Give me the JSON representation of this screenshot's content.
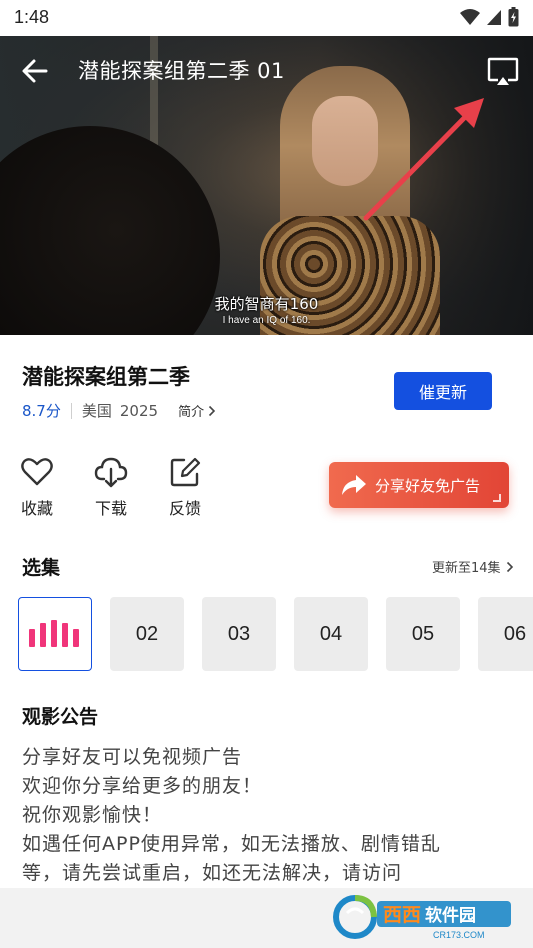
{
  "status_bar": {
    "time": "1:48"
  },
  "player": {
    "title": "潜能探案组第二季 01",
    "subtitle_cn": "我的智商有160",
    "subtitle_en": "I have an IQ of 160."
  },
  "show": {
    "title": "潜能探案组第二季",
    "score": "8.7分",
    "region": "美国",
    "year": "2025",
    "intro_label": "简介",
    "urge_button": "催更新"
  },
  "actions": [
    {
      "label": "收藏",
      "icon": "heart-icon"
    },
    {
      "label": "下载",
      "icon": "cloud-download-icon"
    },
    {
      "label": "反馈",
      "icon": "edit-icon"
    }
  ],
  "share_button": {
    "label": "分享好友免广告"
  },
  "episodes_section": {
    "title": "选集",
    "update_link": "更新至14集",
    "items": [
      "02",
      "03",
      "04",
      "05",
      "06"
    ],
    "active_icon": "playing-bars-icon"
  },
  "notice": {
    "title": "观影公告",
    "lines": [
      "分享好友可以免视频广告",
      "欢迎你分享给更多的朋友！",
      "祝你观影愉快！",
      "如遇任何APP使用异常，如无法播放、剧情错乱",
      "等，请先尝试重启，如还无法解决，请访问"
    ]
  },
  "watermark": {
    "brand": "西西软件园",
    "domain": "CR173.COM"
  },
  "colors": {
    "accent_blue": "#1450e0",
    "score_blue": "#1a56c8",
    "share_red": "#e24536",
    "active_bars": "#f0357a",
    "annotation_arrow": "#e8404a"
  }
}
